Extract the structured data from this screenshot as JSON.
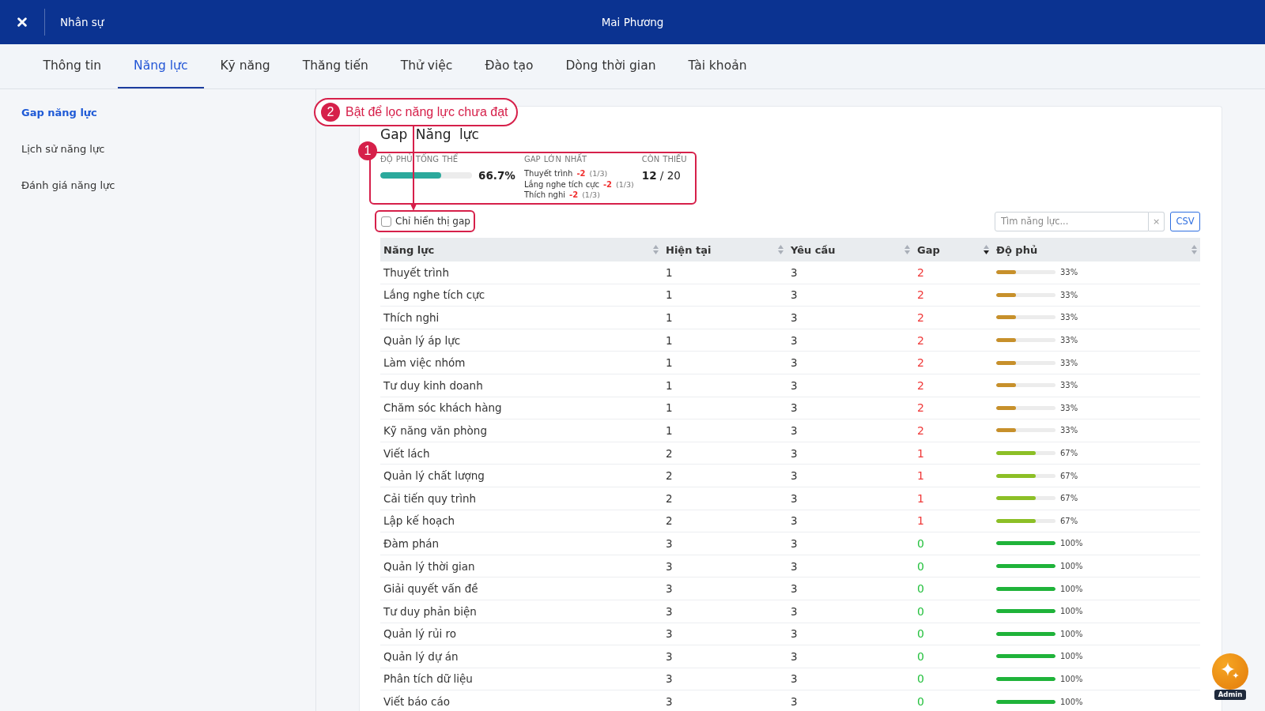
{
  "header": {
    "section": "Nhân sự",
    "title": "Mai Phương"
  },
  "tabs": [
    {
      "label": "Thông tin",
      "selected": false
    },
    {
      "label": "Năng lực",
      "selected": true
    },
    {
      "label": "Kỹ năng",
      "selected": false
    },
    {
      "label": "Thăng tiến",
      "selected": false
    },
    {
      "label": "Thử việc",
      "selected": false
    },
    {
      "label": "Đào tạo",
      "selected": false
    },
    {
      "label": "Dòng thời gian",
      "selected": false
    },
    {
      "label": "Tài khoản",
      "selected": false
    }
  ],
  "sidebar": {
    "items": [
      {
        "label": "Gap năng lực",
        "selected": true
      },
      {
        "label": "Lịch sử năng lực",
        "selected": false
      },
      {
        "label": "Đánh giá năng lực",
        "selected": false
      }
    ]
  },
  "panel": {
    "title": "Gap Năng lực",
    "summary": {
      "coverage": {
        "label": "ĐỘ PHỦ TỔNG THỂ",
        "level": 0.667,
        "value": "66.7%"
      },
      "largest_gaps": {
        "label": "GAP LỚN NHẤT",
        "items": [
          {
            "name": "Thuyết trình",
            "gap": "-2",
            "ratio": "(1/3)"
          },
          {
            "name": "Lắng nghe tích cực",
            "gap": "-2",
            "ratio": "(1/3)"
          },
          {
            "name": "Thích nghi",
            "gap": "-2",
            "ratio": "(1/3)"
          }
        ]
      },
      "missing": {
        "label": "CÒN THIẾU",
        "value": "**12** / 20"
      }
    },
    "gap_filter": {
      "label": "Chỉ hiển thị gap",
      "checked": false
    },
    "search": {
      "placeholder": "Tìm năng lực...",
      "clear": "×"
    },
    "export_button": "CSV",
    "table": {
      "columns": [
        {
          "label": "Năng lực",
          "sorted": false
        },
        {
          "label": "Hiện tại",
          "sorted": false
        },
        {
          "label": "Yêu cầu",
          "sorted": false
        },
        {
          "label": "Gap",
          "sorted": true
        },
        {
          "label": "Độ phủ",
          "sorted": false
        }
      ],
      "rows": [
        {
          "name": "Thuyết trình",
          "current": "1",
          "required": "3",
          "gap": "2",
          "level": 0.33,
          "coverage": "33%"
        },
        {
          "name": "Lắng nghe tích cực",
          "current": "1",
          "required": "3",
          "gap": "2",
          "level": 0.33,
          "coverage": "33%"
        },
        {
          "name": "Thích nghi",
          "current": "1",
          "required": "3",
          "gap": "2",
          "level": 0.33,
          "coverage": "33%"
        },
        {
          "name": "Quản lý áp lực",
          "current": "1",
          "required": "3",
          "gap": "2",
          "level": 0.33,
          "coverage": "33%"
        },
        {
          "name": "Làm việc nhóm",
          "current": "1",
          "required": "3",
          "gap": "2",
          "level": 0.33,
          "coverage": "33%"
        },
        {
          "name": "Tư duy kinh doanh",
          "current": "1",
          "required": "3",
          "gap": "2",
          "level": 0.33,
          "coverage": "33%"
        },
        {
          "name": "Chăm sóc khách hàng",
          "current": "1",
          "required": "3",
          "gap": "2",
          "level": 0.33,
          "coverage": "33%"
        },
        {
          "name": "Kỹ năng văn phòng",
          "current": "1",
          "required": "3",
          "gap": "2",
          "level": 0.33,
          "coverage": "33%"
        },
        {
          "name": "Viết lách",
          "current": "2",
          "required": "3",
          "gap": "1",
          "level": 0.67,
          "coverage": "67%"
        },
        {
          "name": "Quản lý chất lượng",
          "current": "2",
          "required": "3",
          "gap": "1",
          "level": 0.67,
          "coverage": "67%"
        },
        {
          "name": "Cải tiến quy trình",
          "current": "2",
          "required": "3",
          "gap": "1",
          "level": 0.67,
          "coverage": "67%"
        },
        {
          "name": "Lập kế hoạch",
          "current": "2",
          "required": "3",
          "gap": "1",
          "level": 0.67,
          "coverage": "67%"
        },
        {
          "name": "Đàm phán",
          "current": "3",
          "required": "3",
          "gap": "0",
          "level": 1,
          "coverage": "100%"
        },
        {
          "name": "Quản lý thời gian",
          "current": "3",
          "required": "3",
          "gap": "0",
          "level": 1,
          "coverage": "100%"
        },
        {
          "name": "Giải quyết vấn đề",
          "current": "3",
          "required": "3",
          "gap": "0",
          "level": 1,
          "coverage": "100%"
        },
        {
          "name": "Tư duy phản biện",
          "current": "3",
          "required": "3",
          "gap": "0",
          "level": 1,
          "coverage": "100%"
        },
        {
          "name": "Quản lý rủi ro",
          "current": "3",
          "required": "3",
          "gap": "0",
          "level": 1,
          "coverage": "100%"
        },
        {
          "name": "Quản lý dự án",
          "current": "3",
          "required": "3",
          "gap": "0",
          "level": 1,
          "coverage": "100%"
        },
        {
          "name": "Phân tích dữ liệu",
          "current": "3",
          "required": "3",
          "gap": "0",
          "level": 1,
          "coverage": "100%"
        },
        {
          "name": "Viết báo cáo",
          "current": "3",
          "required": "3",
          "gap": "0",
          "level": 1,
          "coverage": "100%"
        }
      ]
    }
  },
  "annotations": [
    {
      "kind": "frame",
      "number": "1"
    },
    {
      "kind": "callout",
      "number": "2",
      "text": "Bật để lọc năng lực chưa đạt"
    }
  ],
  "assistant": {
    "badge": "Admin"
  }
}
